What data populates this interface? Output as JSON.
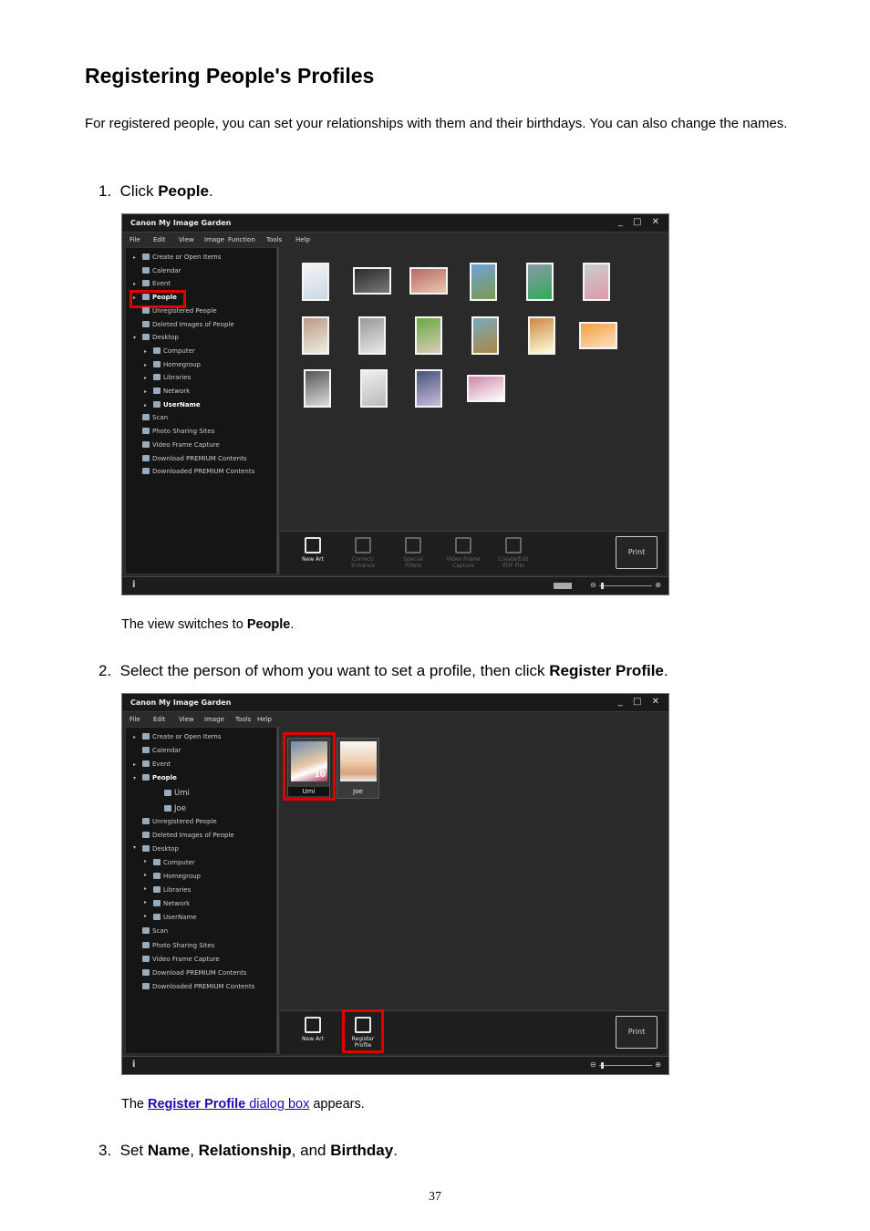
{
  "title": "Registering People's Profiles",
  "intro": "For registered people, you can set your relationships with them and their birthdays. You can also change the names.",
  "steps": [
    {
      "num": "1.",
      "pre": "Click ",
      "bold": "People",
      "post": "."
    },
    {
      "num": "2.",
      "pre": "Select the person of whom you want to set a profile, then click ",
      "bold": "Register Profile",
      "post": "."
    },
    {
      "num": "3.",
      "pre": "Set ",
      "b1": "Name",
      "s1": ", ",
      "b2": "Relationship",
      "s2": ", and ",
      "b3": "Birthday",
      "post": "."
    }
  ],
  "notes": {
    "n1_pre": "The view switches to ",
    "n1_bold": "People",
    "n1_post": ".",
    "n2_pre": "The ",
    "n2_link_bold": "Register Profile",
    "n2_link_rest": " dialog box",
    "n2_post": " appears."
  },
  "page_number": "37",
  "app": {
    "title": "Canon My Image Garden",
    "window_controls": "_ □ ✕",
    "menu1": [
      "File",
      "Edit",
      "View",
      "Image",
      "Function",
      "Tools",
      "Help"
    ],
    "menu2": [
      "File",
      "Edit",
      "View",
      "Image",
      "Tools",
      "Help"
    ],
    "sidebar1": [
      "Create or Open Items",
      "Calendar",
      "Event",
      "People",
      "Unregistered People",
      "Deleted Images of People",
      "Desktop",
      "Computer",
      "Homegroup",
      "Libraries",
      "Network",
      "UserName",
      "Scan",
      "Photo Sharing Sites",
      "Video Frame Capture",
      "Download PREMIUM Contents",
      "Downloaded PREMIUM Contents"
    ],
    "sidebar2": [
      "Create or Open Items",
      "Calendar",
      "Event",
      "People",
      "Umi",
      "Joe",
      "Unregistered People",
      "Deleted Images of People",
      "Desktop",
      "Computer",
      "Homegroup",
      "Libraries",
      "Network",
      "UserName",
      "Scan",
      "Photo Sharing Sites",
      "Video Frame Capture",
      "Download PREMIUM Contents",
      "Downloaded PREMIUM Contents"
    ],
    "toolbar1": [
      {
        "l1": "New Art",
        "l2": "",
        "enabled": true
      },
      {
        "l1": "Correct/",
        "l2": "Enhance",
        "enabled": false
      },
      {
        "l1": "Special",
        "l2": "Filters",
        "enabled": false
      },
      {
        "l1": "Video Frame",
        "l2": "Capture",
        "enabled": false
      },
      {
        "l1": "Create/Edit",
        "l2": "PDF File",
        "enabled": false
      }
    ],
    "toolbar2": [
      {
        "l1": "New Art",
        "l2": "",
        "enabled": true
      },
      {
        "l1": "Register",
        "l2": "Profile",
        "enabled": true
      }
    ],
    "print_label": "Print",
    "info_glyph": "i",
    "zoom_minus": "⊖",
    "zoom_plus": "⊕",
    "people": [
      {
        "name": "Umi",
        "count": "10"
      },
      {
        "name": "Joe",
        "count": ""
      }
    ],
    "accent_highlight": "#e00000"
  }
}
